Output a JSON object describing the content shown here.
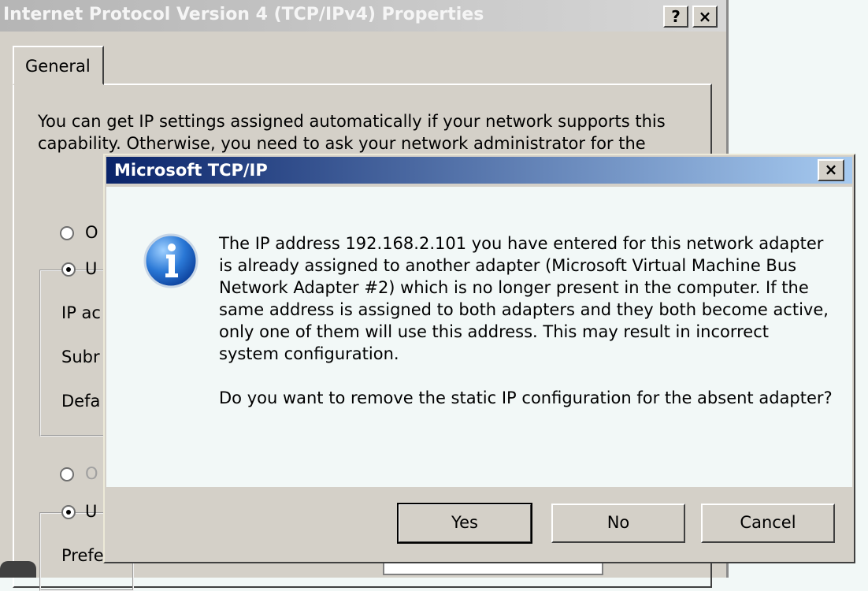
{
  "background_window": {
    "title": "Internet Protocol Version 4 (TCP/IPv4) Properties",
    "help_button": "?",
    "close_button": "×",
    "tab_label": "General",
    "description": "You can get IP settings assigned automatically if your network supports this capability. Otherwise, you need to ask your network administrator for the",
    "obscured_labels": [
      "O",
      "U",
      "IP ac",
      "Subr",
      "Defa",
      "O",
      "U",
      "Prefe"
    ]
  },
  "dialog": {
    "title": "Microsoft TCP/IP",
    "close_button": "×",
    "icon": "information-icon",
    "message": "The IP address 192.168.2.101 you have entered for this network adapter is already assigned to another adapter (Microsoft Virtual Machine Bus Network Adapter #2) which is no longer present in the computer.  If the same address is assigned to both adapters and they both become active, only one of them will use this address.  This may result in incorrect system configuration.",
    "question": "Do you want to remove the static IP configuration for the absent adapter?",
    "buttons": {
      "yes": "Yes",
      "no": "No",
      "cancel": "Cancel"
    }
  },
  "colors": {
    "dialog_title_start": "#0a246a",
    "dialog_title_end": "#a6caf0",
    "body_background": "#f2f8f7",
    "button_face": "#d4d0c8"
  }
}
